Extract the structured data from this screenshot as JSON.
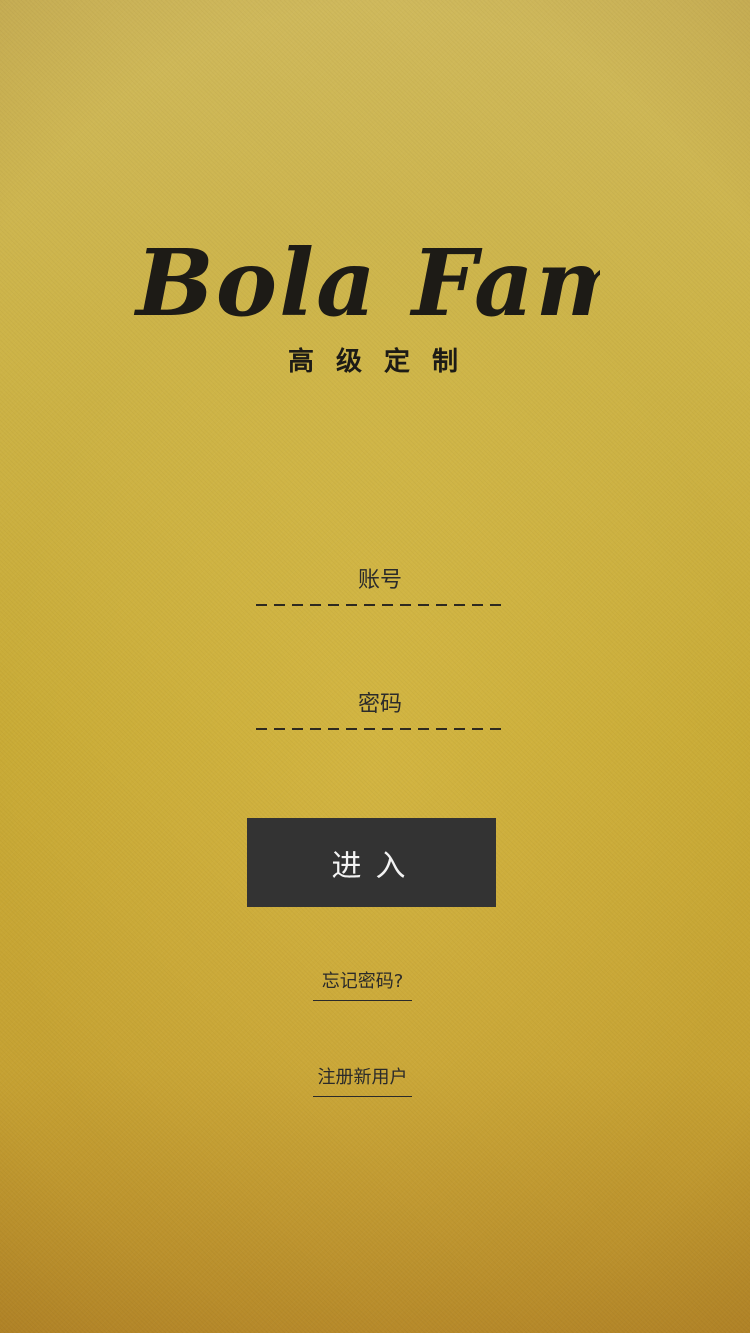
{
  "logo": {
    "brand": "Bola Family",
    "tagline": "高级定制"
  },
  "form": {
    "account_placeholder": "账号",
    "password_placeholder": "密码",
    "submit_label": "进入"
  },
  "links": {
    "forgot_password": "忘记密码?",
    "register": "注册新用户"
  },
  "colors": {
    "background": "#c9ab36",
    "button": "#333333",
    "text": "#1d1b16"
  }
}
